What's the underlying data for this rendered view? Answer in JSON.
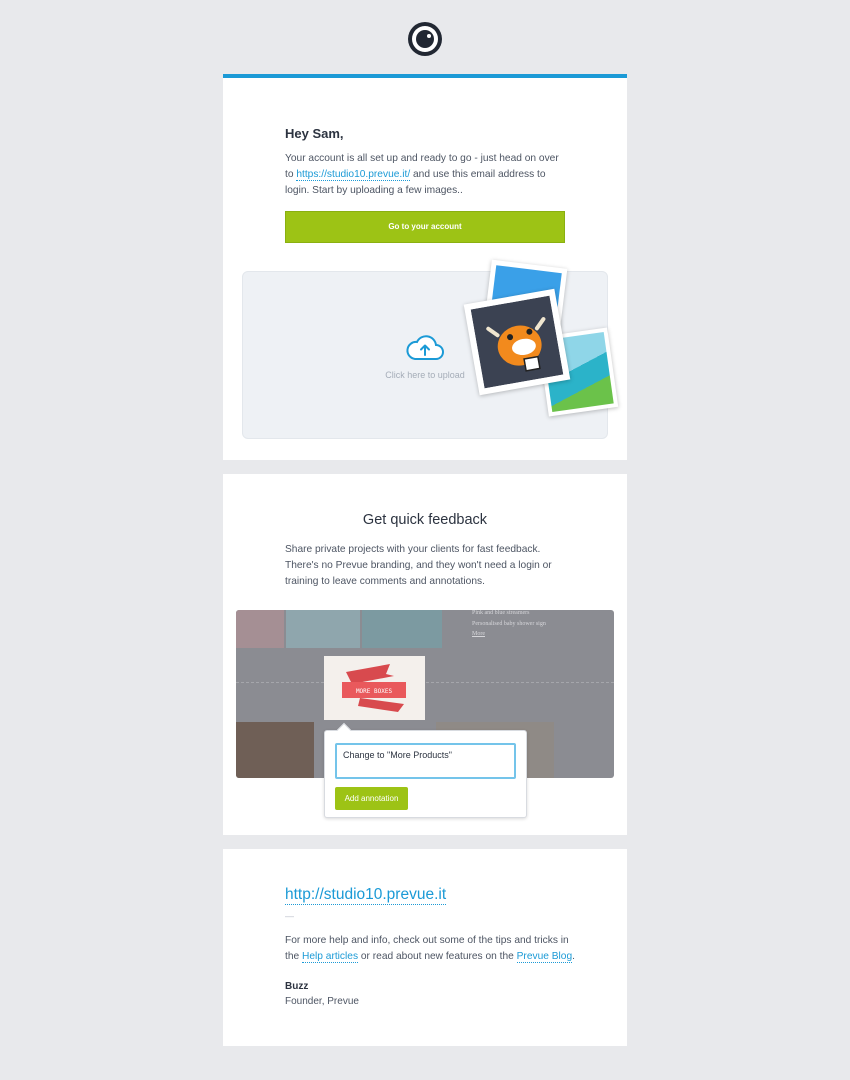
{
  "welcome": {
    "greeting": "Hey Sam,",
    "intro_before": "Your account is all set up and ready to go - just head on over to ",
    "intro_link": "https://studio10.prevue.it/",
    "intro_after": " and use this email address to login. Start by uploading a few images..",
    "cta_label": "Go to your account",
    "upload_label": "Click here to upload"
  },
  "feedback": {
    "title": "Get quick feedback",
    "description": "Share private projects with your clients for fast feedback. There's no Prevue branding, and they won't need a login or training to leave comments and annotations.",
    "screenshot": {
      "lines": [
        "Pink and blue streamers",
        "Personalised baby shower sign",
        "More"
      ],
      "banner_text": "MORE BOXES",
      "annotation_value": "Change to \"More Products\"",
      "annotation_button": "Add annotation"
    }
  },
  "footer": {
    "url": "http://studio10.prevue.it",
    "separator": "—",
    "help_before": "For more help and info, check out some of the tips and tricks in the ",
    "help_link": "Help articles",
    "help_middle": " or read about new features on the ",
    "blog_link": "Prevue Blog",
    "help_after": ".",
    "signature_name": "Buzz",
    "signature_role": "Founder, Prevue"
  },
  "colors": {
    "accent_blue": "#1b9ad6",
    "cta_green": "#9dc315",
    "background": "#e8e9ec"
  },
  "icons": {
    "logo": "prevue-eye-logo",
    "upload": "cloud-upload-icon"
  }
}
